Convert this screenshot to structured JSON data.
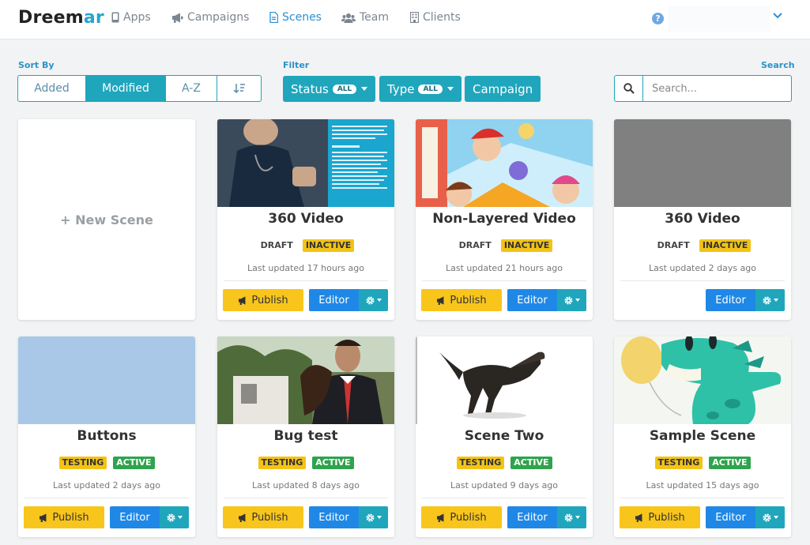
{
  "nav": {
    "logo_left": "Dreem",
    "logo_right": "ar",
    "items": [
      {
        "label": "Apps",
        "icon": "mobile-icon"
      },
      {
        "label": "Campaigns",
        "icon": "megaphone-icon"
      },
      {
        "label": "Scenes",
        "icon": "file-icon",
        "active": true
      },
      {
        "label": "Team",
        "icon": "users-icon"
      },
      {
        "label": "Clients",
        "icon": "building-icon"
      }
    ],
    "help": "?"
  },
  "controls": {
    "sort_label": "Sort By",
    "sort_options": [
      "Added",
      "Modified",
      "A-Z"
    ],
    "sort_selected": "Modified",
    "filter_label": "Filter",
    "status_label": "Status",
    "status_value": "ALL",
    "type_label": "Type",
    "type_value": "ALL",
    "campaign_label": "Campaign",
    "search_label": "Search",
    "search_placeholder": "Search..."
  },
  "new_scene": "+ New Scene",
  "card_buttons": {
    "publish": "Publish",
    "editor": "Editor"
  },
  "cards": [
    {
      "title": "360 Video",
      "status": "DRAFT",
      "state": "INACTIVE",
      "updated": "Last updated 17 hours ago",
      "publish": true
    },
    {
      "title": "Non-Layered Video",
      "status": "DRAFT",
      "state": "INACTIVE",
      "updated": "Last updated 21 hours ago",
      "publish": true
    },
    {
      "title": "360 Video",
      "status": "DRAFT",
      "state": "INACTIVE",
      "updated": "Last updated 2 days ago",
      "publish": false
    },
    {
      "title": "Buttons",
      "status": "TESTING",
      "state": "ACTIVE",
      "updated": "Last updated 2 days ago",
      "publish": true
    },
    {
      "title": "Bug test",
      "status": "TESTING",
      "state": "ACTIVE",
      "updated": "Last updated 8 days ago",
      "publish": true
    },
    {
      "title": "Scene Two",
      "status": "TESTING",
      "state": "ACTIVE",
      "updated": "Last updated 9 days ago",
      "publish": true
    },
    {
      "title": "Sample Scene",
      "status": "TESTING",
      "state": "ACTIVE",
      "updated": "Last updated 15 days ago",
      "publish": true
    }
  ],
  "colors": {
    "accent": "#1fa6bc",
    "publish": "#f8c51c",
    "editor": "#1f88e6",
    "active": "#2fa34d",
    "inactive": "#f3c316"
  }
}
